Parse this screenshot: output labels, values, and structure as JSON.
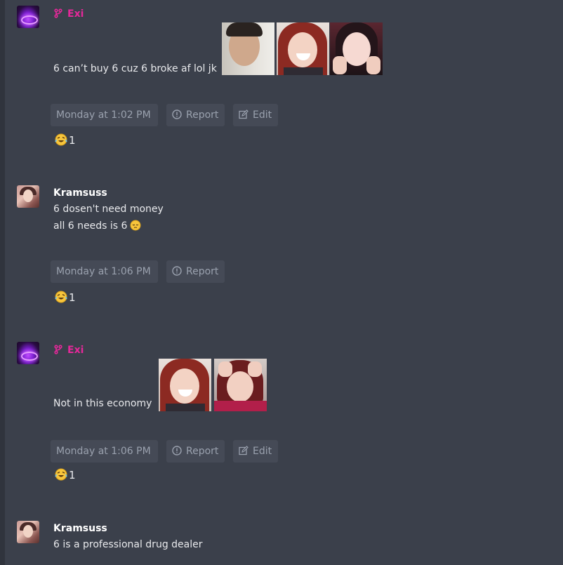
{
  "posts": [
    {
      "author": "Exi",
      "author_color": "#e5289a",
      "author_icon": "fork-icon",
      "lines": [
        "6 can’t buy 6 cuz 6 broke af lol jk"
      ],
      "timestamp": "Monday at 1:02 PM",
      "report_label": "Report",
      "edit_label": "Edit",
      "reaction_icon": "rofl-emoji-icon",
      "reaction_count": "1"
    },
    {
      "author": "Kramsuss",
      "lines": [
        "6 dosen't need money",
        "all 6 needs is 6"
      ],
      "inline_emoji": "pensive-emoji-icon",
      "timestamp": "Monday at 1:06 PM",
      "report_label": "Report",
      "reaction_icon": "rofl-emoji-icon",
      "reaction_count": "1"
    },
    {
      "author": "Exi",
      "author_color": "#e5289a",
      "author_icon": "fork-icon",
      "lines": [
        "Not in this economy"
      ],
      "timestamp": "Monday at 1:06 PM",
      "report_label": "Report",
      "edit_label": "Edit",
      "reaction_icon": "rofl-emoji-icon",
      "reaction_count": "1"
    },
    {
      "author": "Kramsuss",
      "lines": [
        "6 is a professional drug dealer"
      ]
    }
  ],
  "colors": {
    "background": "#3b404b",
    "button_bg": "#454a56",
    "button_text": "#9aa1ae",
    "exi_name": "#e5289a"
  }
}
